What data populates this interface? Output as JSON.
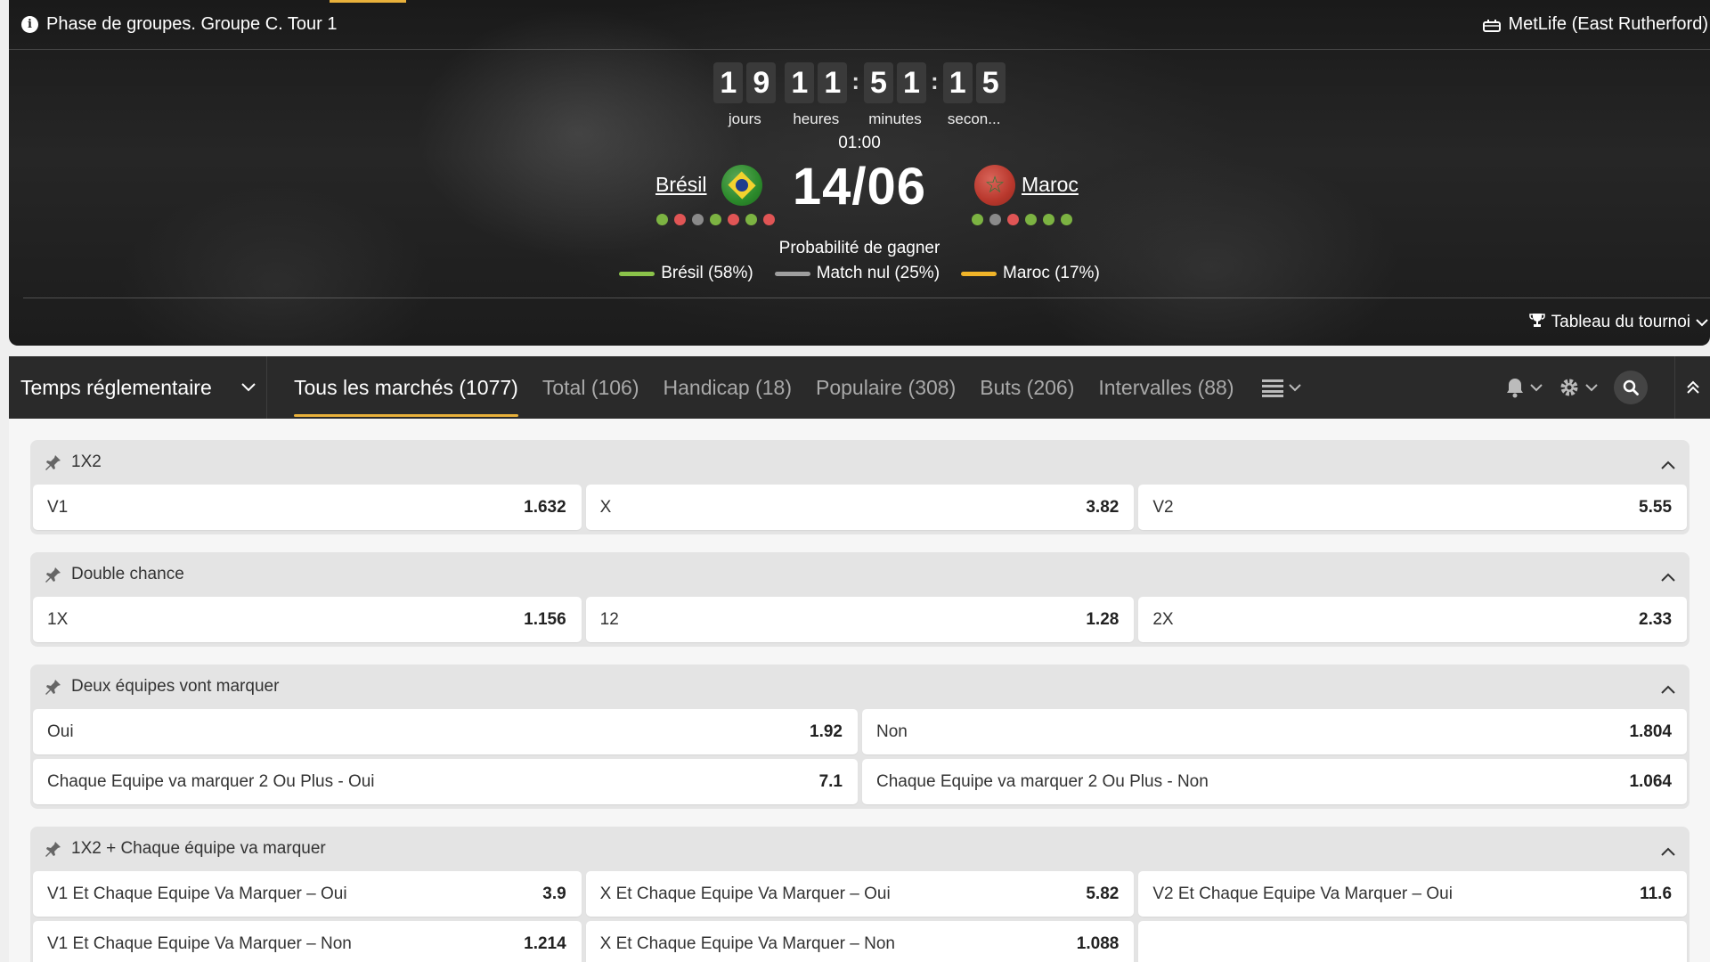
{
  "header": {
    "phase": "Phase de groupes. Groupe C. Tour 1",
    "venue": "MetLife (East Rutherford)"
  },
  "countdown": {
    "days": [
      "1",
      "9"
    ],
    "hours": [
      "1",
      "1"
    ],
    "minutes": [
      "5",
      "1"
    ],
    "seconds": [
      "1",
      "5"
    ],
    "labels": {
      "days": "jours",
      "hours": "heures",
      "minutes": "minutes",
      "seconds": "secon..."
    },
    "separator": ":"
  },
  "match": {
    "kickoff_time": "01:00",
    "date": "14/06",
    "home": {
      "name": "Brésil",
      "flag": "brazil-flag",
      "form": [
        "#7cb342",
        "#e05555",
        "#8a8a8a",
        "#7cb342",
        "#e05555",
        "#7cb342",
        "#e05555"
      ]
    },
    "away": {
      "name": "Maroc",
      "flag": "morocco-flag",
      "form": [
        "#7cb342",
        "#8a8a8a",
        "#e05555",
        "#7cb342",
        "#7cb342",
        "#7cb342"
      ]
    }
  },
  "probability": {
    "title": "Probabilité de gagner",
    "items": [
      {
        "label": "Brésil (58%)",
        "color": "#8bc34a"
      },
      {
        "label": "Match nul (25%)",
        "color": "#9e9e9e"
      },
      {
        "label": "Maroc (17%)",
        "color": "#f0b429"
      }
    ]
  },
  "tournament_link": "Tableau du tournoi",
  "tabbar": {
    "period": "Temps réglementaire",
    "tabs": [
      {
        "label": "Tous les marchés (1077)",
        "active": true
      },
      {
        "label": "Total (106)",
        "active": false
      },
      {
        "label": "Handicap (18)",
        "active": false
      },
      {
        "label": "Populaire (308)",
        "active": false
      },
      {
        "label": "Buts (206)",
        "active": false
      },
      {
        "label": "Intervalles (88)",
        "active": false
      }
    ]
  },
  "markets": [
    {
      "title": "1X2",
      "rows": [
        [
          {
            "label": "V1",
            "value": "1.632"
          },
          {
            "label": "X",
            "value": "3.82"
          },
          {
            "label": "V2",
            "value": "5.55"
          }
        ]
      ]
    },
    {
      "title": "Double chance",
      "rows": [
        [
          {
            "label": "1X",
            "value": "1.156"
          },
          {
            "label": "12",
            "value": "1.28"
          },
          {
            "label": "2X",
            "value": "2.33"
          }
        ]
      ]
    },
    {
      "title": "Deux équipes vont marquer",
      "rows": [
        [
          {
            "label": "Oui",
            "value": "1.92"
          },
          {
            "label": "Non",
            "value": "1.804"
          }
        ],
        [
          {
            "label": "Chaque Equipe va marquer 2 Ou Plus - Oui",
            "value": "7.1"
          },
          {
            "label": "Chaque Equipe va marquer 2 Ou Plus - Non",
            "value": "1.064"
          }
        ]
      ]
    },
    {
      "title": "1X2 + Chaque équipe va marquer",
      "rows": [
        [
          {
            "label": "V1 Et Chaque Equipe Va Marquer – Oui",
            "value": "3.9"
          },
          {
            "label": "X Et Chaque Equipe Va Marquer – Oui",
            "value": "5.82"
          },
          {
            "label": "V2 Et Chaque Equipe Va Marquer – Oui",
            "value": "11.6"
          }
        ],
        [
          {
            "label": "V1 Et Chaque Equipe Va Marquer – Non",
            "value": "1.214"
          },
          {
            "label": "X Et Chaque Equipe Va Marquer – Non",
            "value": "1.088"
          },
          {
            "label": "",
            "value": ""
          }
        ]
      ]
    }
  ]
}
